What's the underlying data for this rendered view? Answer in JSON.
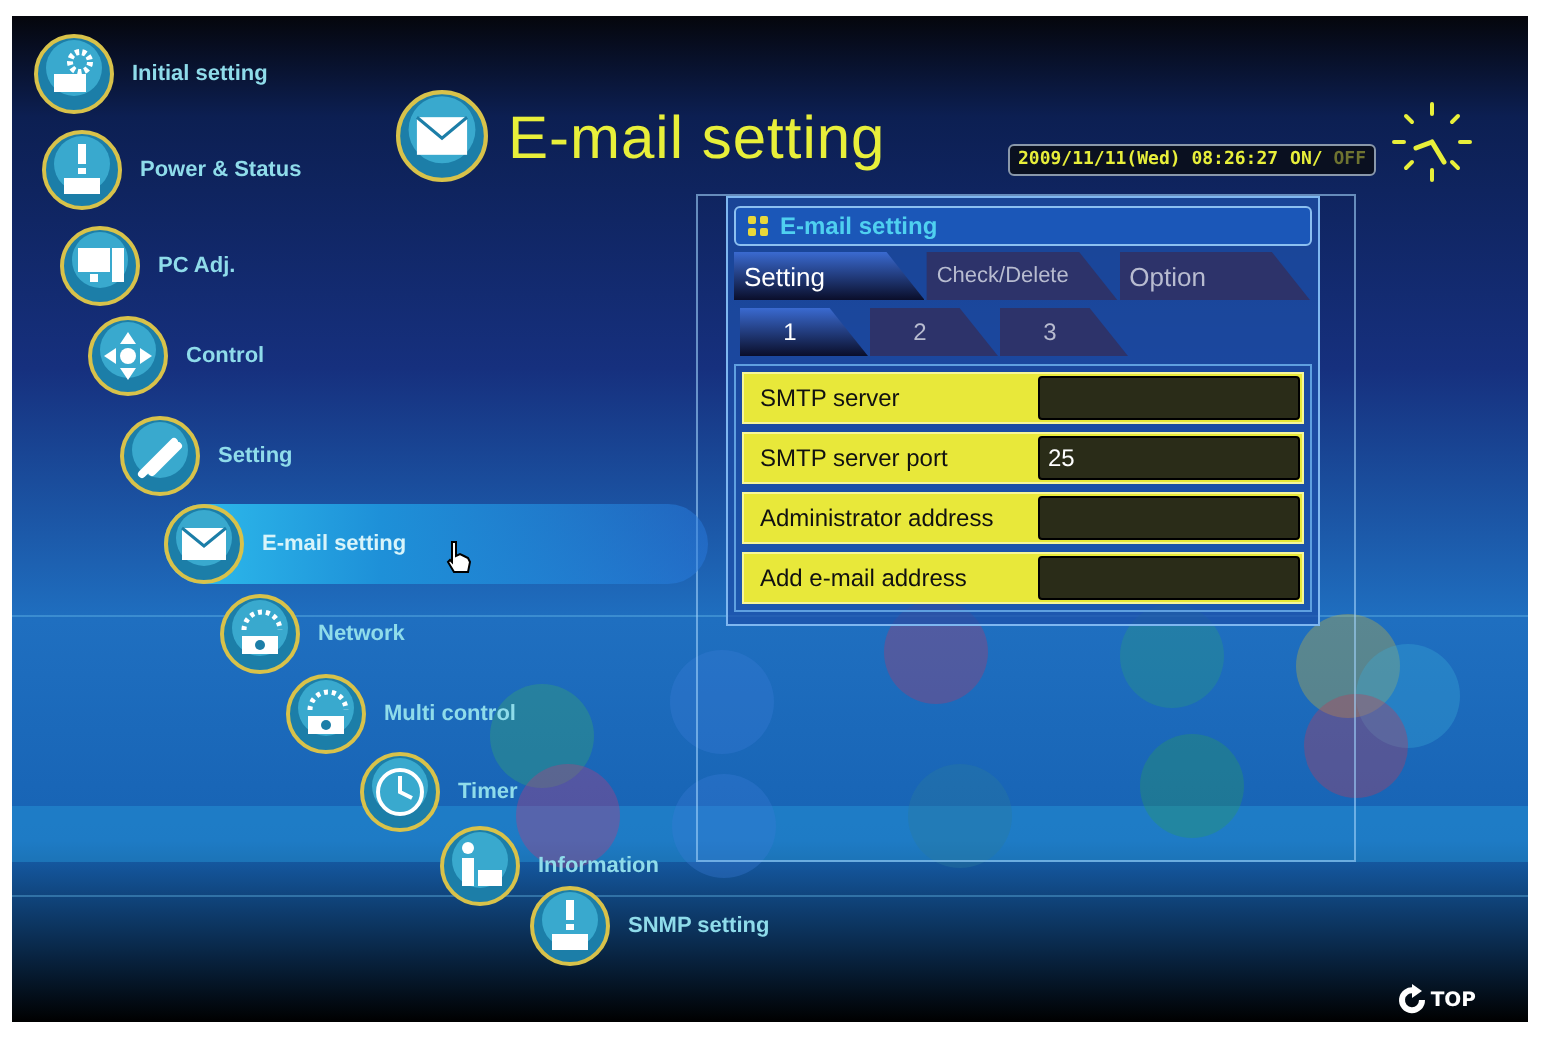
{
  "nav": {
    "items": [
      {
        "label": "Initial setting",
        "selected": false
      },
      {
        "label": "Power & Status",
        "selected": false
      },
      {
        "label": "PC Adj.",
        "selected": false
      },
      {
        "label": "Control",
        "selected": false
      },
      {
        "label": "Setting",
        "selected": false
      },
      {
        "label": "E-mail setting",
        "selected": true
      },
      {
        "label": "Network",
        "selected": false
      },
      {
        "label": "Multi control",
        "selected": false
      },
      {
        "label": "Timer",
        "selected": false
      },
      {
        "label": "Information",
        "selected": false
      },
      {
        "label": "SNMP setting",
        "selected": false
      }
    ]
  },
  "header": {
    "title": "E-mail setting"
  },
  "clock": {
    "datetime": "2009/11/11(Wed) 08:26:27",
    "on_label": "ON/",
    "off_label": "OFF",
    "on": true
  },
  "panel": {
    "title": "E-mail setting",
    "tabs": [
      {
        "label": "Setting",
        "selected": true
      },
      {
        "label": "Check/Delete",
        "selected": false
      },
      {
        "label": "Option",
        "selected": false
      }
    ],
    "subtabs": [
      {
        "label": "1",
        "selected": true
      },
      {
        "label": "2",
        "selected": false
      },
      {
        "label": "3",
        "selected": false
      }
    ],
    "fields": [
      {
        "label": "SMTP server"
      },
      {
        "label": "SMTP server port",
        "value": "25"
      },
      {
        "label": "Administrator address"
      },
      {
        "label": "Add e-mail address"
      }
    ]
  },
  "top_button": {
    "label": "TOP"
  }
}
